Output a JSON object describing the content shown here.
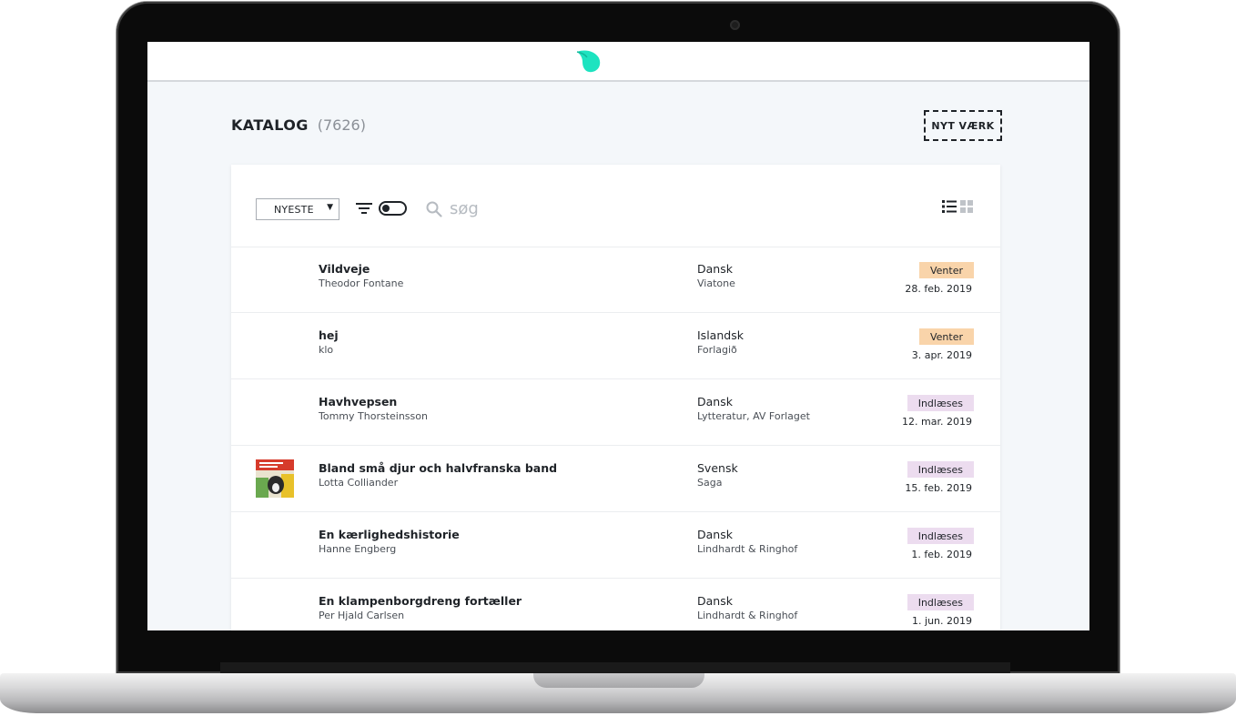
{
  "header": {
    "logo_icon": "app-logo-icon",
    "accent": "#1de3c0"
  },
  "page": {
    "title": "KATALOG",
    "count": "(7626)"
  },
  "actions": {
    "new_work_label": "NYT VÆRK"
  },
  "toolbar": {
    "sort_label": "NYESTE",
    "filter_icon": "filter-icon",
    "search_placeholder": "søg",
    "view_list_icon": "list-view-icon",
    "view_grid_icon": "grid-view-icon"
  },
  "colors": {
    "waiting": "#f9d4aa",
    "recording": "#ecdcef",
    "background": "#f4f7fa"
  },
  "books": [
    {
      "title": "Vildveje",
      "author": "Theodor Fontane",
      "language": "Dansk",
      "publisher": "Viatone",
      "status": "Venter",
      "status_type": "waiting",
      "date": "28. feb. 2019",
      "cover": false
    },
    {
      "title": "hej",
      "author": "klo",
      "language": "Islandsk",
      "publisher": "Forlagið",
      "status": "Venter",
      "status_type": "waiting",
      "date": "3. apr. 2019",
      "cover": false
    },
    {
      "title": "Havhvepsen",
      "author": "Tommy Thorsteinsson",
      "language": "Dansk",
      "publisher": "Lytteratur, AV Forlaget",
      "status": "Indlæses",
      "status_type": "recording",
      "date": "12. mar. 2019",
      "cover": false
    },
    {
      "title": "Bland små djur och halvfranska band",
      "author": "Lotta Colliander",
      "language": "Svensk",
      "publisher": "Saga",
      "status": "Indlæses",
      "status_type": "recording",
      "date": "15. feb. 2019",
      "cover": true
    },
    {
      "title": "En kærlighedshistorie",
      "author": "Hanne Engberg",
      "language": "Dansk",
      "publisher": "Lindhardt & Ringhof",
      "status": "Indlæses",
      "status_type": "recording",
      "date": "1. feb. 2019",
      "cover": false
    },
    {
      "title": "En klampenborgdreng fortæller",
      "author": "Per Hjald Carlsen",
      "language": "Dansk",
      "publisher": "Lindhardt & Ringhof",
      "status": "Indlæses",
      "status_type": "recording",
      "date": "1. jun. 2019",
      "cover": false
    }
  ]
}
